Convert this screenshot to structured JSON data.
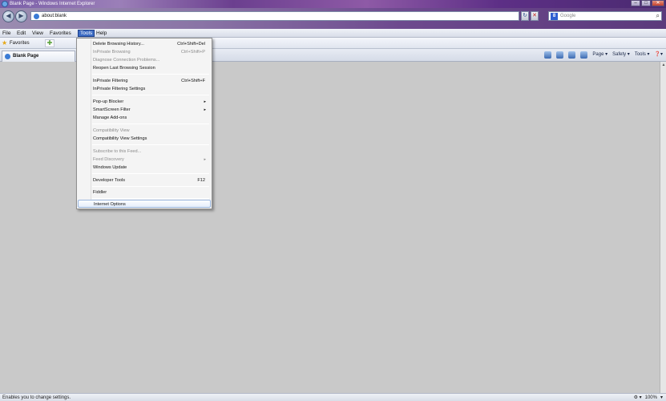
{
  "window": {
    "title": "Blank Page - Windows Internet Explorer",
    "controls": {
      "minimize": "–",
      "maximize": "□",
      "close": "✕"
    }
  },
  "nav": {
    "back": "◀",
    "forward": "▶",
    "address": "about:blank",
    "refresh": "↻",
    "stop": "✕",
    "search_placeholder": "Google",
    "search_provider_icon": "8",
    "search_go": "⌕"
  },
  "menubar": {
    "file": "File",
    "edit": "Edit",
    "view": "View",
    "favorites": "Favorites",
    "tools": "Tools",
    "help": "Help"
  },
  "favorites_bar": {
    "label": "Favorites",
    "add_icon": "✚"
  },
  "tab": {
    "label": "Blank Page"
  },
  "command_bar": {
    "page": "Page ▾",
    "safety": "Safety ▾",
    "tools": "Tools ▾",
    "help": "❓▾"
  },
  "tools_menu": {
    "delete_history": {
      "label": "Delete Browsing History...",
      "shortcut": "Ctrl+Shift+Del"
    },
    "inprivate_browsing": {
      "label": "InPrivate Browsing",
      "shortcut": "Ctrl+Shift+P"
    },
    "diagnose": {
      "label": "Diagnose Connection Problems..."
    },
    "reopen_session": {
      "label": "Reopen Last Browsing Session"
    },
    "inprivate_filtering": {
      "label": "InPrivate Filtering",
      "shortcut": "Ctrl+Shift+F"
    },
    "inprivate_filtering_settings": {
      "label": "InPrivate Filtering Settings"
    },
    "popup_blocker": {
      "label": "Pop-up Blocker"
    },
    "smartscreen": {
      "label": "SmartScreen Filter"
    },
    "manage_addons": {
      "label": "Manage Add-ons"
    },
    "compat_view": {
      "label": "Compatibility View"
    },
    "compat_view_settings": {
      "label": "Compatibility View Settings"
    },
    "subscribe_feed": {
      "label": "Subscribe to this Feed..."
    },
    "feed_discovery": {
      "label": "Feed Discovery"
    },
    "windows_update": {
      "label": "Windows Update"
    },
    "developer_tools": {
      "label": "Developer Tools",
      "shortcut": "F12"
    },
    "fiddler": {
      "label": "Fiddler"
    },
    "internet_options": {
      "label": "Internet Options"
    },
    "submenu_arrow": "▸"
  },
  "statusbar": {
    "text": "Enables you to change settings.",
    "zoom": "100%",
    "zoom_caret": "▾",
    "protected": "⚙ ▾"
  }
}
